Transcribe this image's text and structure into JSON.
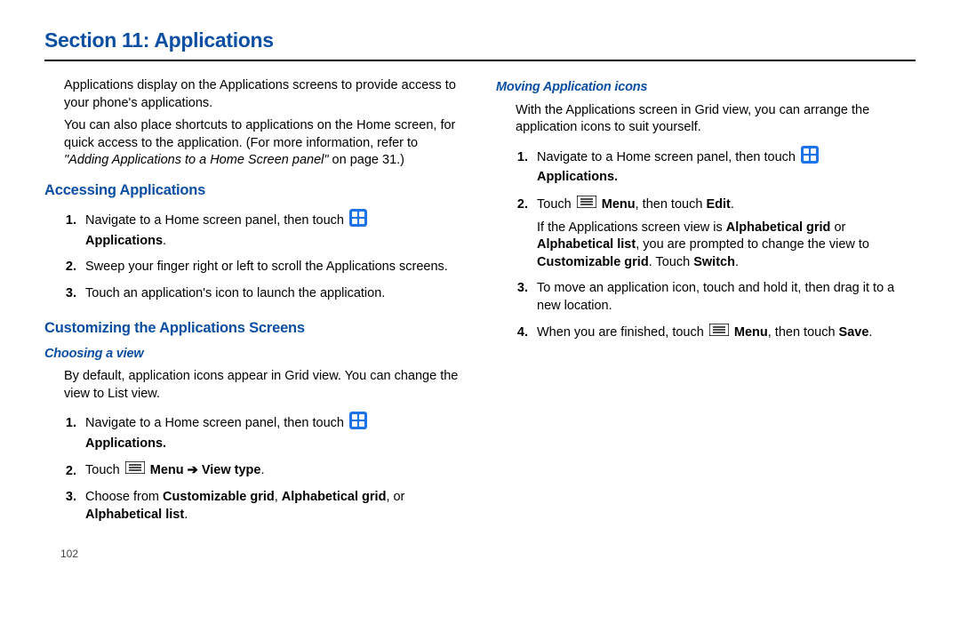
{
  "title": "Section 11: Applications",
  "intro1": "Applications display on the Applications screens to provide access to your phone's applications.",
  "intro2a": "You can also place shortcuts to applications on the Home screen, for quick access to the application. (For more information, refer to ",
  "intro2b": "\"Adding Applications to a Home Screen panel\"",
  "intro2c": " on page 31.)",
  "accessing": {
    "heading": "Accessing Applications",
    "step1a": "Navigate to a Home screen panel, then touch ",
    "step1b": "Applications",
    "step1c": ".",
    "step2": "Sweep your finger right or left to scroll the Applications screens.",
    "step3": "Touch an application's icon to launch the application."
  },
  "customizing": {
    "heading": "Customizing the Applications Screens",
    "choosing": {
      "heading": "Choosing a view",
      "intro": "By default, application icons appear in Grid view. You can change the view to List view.",
      "step1a": "Navigate to a Home screen panel, then touch ",
      "step1b": "Applications.",
      "step2a": "Touch ",
      "step2b": "Menu",
      "step2arrow": " ➔ ",
      "step2c": "View type",
      "step2d": ".",
      "step3a": "Choose from ",
      "step3b": "Customizable grid",
      "step3c": ", ",
      "step3d": "Alphabetical grid",
      "step3e": ", or ",
      "step3f": "Alphabetical list",
      "step3g": "."
    },
    "moving": {
      "heading": "Moving Application icons",
      "intro": "With the Applications screen in Grid view, you can arrange the application icons to suit yourself.",
      "step1a": "Navigate to a Home screen panel, then touch ",
      "step1b": "Applications.",
      "step2a": "Touch ",
      "step2b": "Menu",
      "step2c": ", then touch ",
      "step2d": "Edit",
      "step2e": ".",
      "step2f1": "If the Applications screen view is ",
      "step2f2": "Alphabetical grid",
      "step2f3": " or ",
      "step2f4": "Alphabetical list",
      "step2f5": ", you are prompted to change the view to ",
      "step2f6": "Customizable grid",
      "step2f7": ". Touch ",
      "step2f8": "Switch",
      "step2f9": ".",
      "step3": "To move an application icon, touch and hold it, then drag it to a new location.",
      "step4a": "When you are finished, touch ",
      "step4b": "Menu",
      "step4c": ", then touch ",
      "step4d": "Save",
      "step4e": "."
    }
  },
  "pagenum": "102"
}
